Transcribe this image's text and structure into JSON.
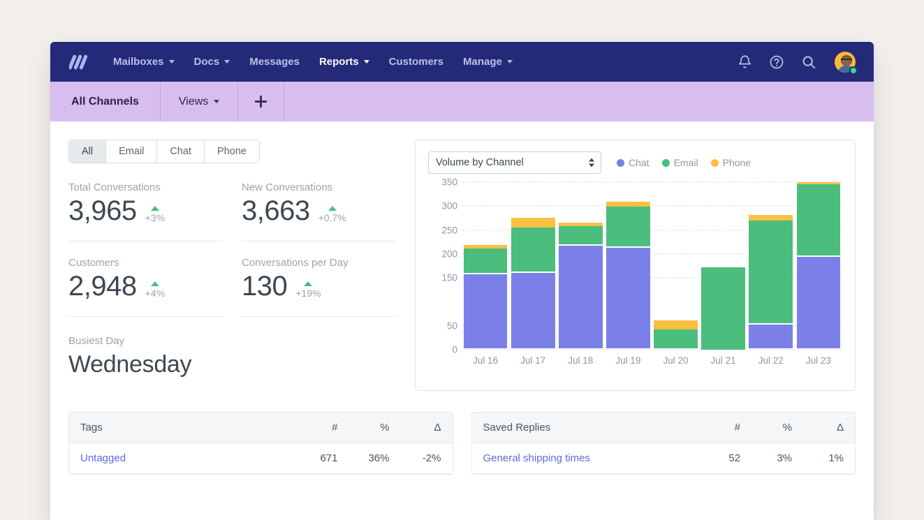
{
  "nav": {
    "logo": "helpscout-logo-icon",
    "items": [
      {
        "label": "Mailboxes",
        "caret": true,
        "active": false
      },
      {
        "label": "Docs",
        "caret": true,
        "active": false
      },
      {
        "label": "Messages",
        "caret": false,
        "active": false
      },
      {
        "label": "Reports",
        "caret": true,
        "active": true
      },
      {
        "label": "Customers",
        "caret": false,
        "active": false
      },
      {
        "label": "Manage",
        "caret": true,
        "active": false
      }
    ],
    "icons": [
      "bell-icon",
      "help-icon",
      "search-icon"
    ],
    "avatar_status": "online"
  },
  "tabbar": {
    "primary": "All Channels",
    "views": "Views",
    "add": "+"
  },
  "filters": {
    "options": [
      "All",
      "Email",
      "Chat",
      "Phone"
    ],
    "active": "All"
  },
  "stats": [
    {
      "label": "Total Conversations",
      "value": "3,965",
      "delta": "+3%",
      "trend": "up"
    },
    {
      "label": "New Conversations",
      "value": "3,663",
      "delta": "+0.7%",
      "trend": "up"
    },
    {
      "label": "Customers",
      "value": "2,948",
      "delta": "+4%",
      "trend": "up"
    },
    {
      "label": "Conversations per Day",
      "value": "130",
      "delta": "+19%",
      "trend": "up"
    }
  ],
  "busiest": {
    "label": "Busiest Day",
    "value": "Wednesday"
  },
  "chart_controls": {
    "select_value": "Volume by Channel",
    "select_options": [
      "Volume by Channel"
    ]
  },
  "colors": {
    "chat": "#7b80e8",
    "email": "#4bbd7c",
    "phone": "#fbbf42",
    "nav": "#242a78",
    "tabbar": "#d7bdf0",
    "link": "#5b6ae0",
    "positive": "#3aa76d",
    "negative": "#e8503a"
  },
  "chart_data": {
    "type": "bar",
    "stacked": true,
    "title": "Volume by Channel",
    "xlabel": "",
    "ylabel": "",
    "ylim": [
      0,
      350
    ],
    "yticks": [
      0,
      50,
      150,
      200,
      250,
      300,
      350
    ],
    "ytick_labels": [
      "0",
      "50",
      "150",
      "200",
      "250",
      "300",
      "350"
    ],
    "grid": true,
    "legend_position": "top-right",
    "categories": [
      "Jul 16",
      "Jul 17",
      "Jul 18",
      "Jul 19",
      "Jul 20",
      "Jul 21",
      "Jul 22",
      "Jul 23"
    ],
    "series": [
      {
        "name": "Chat",
        "color": "#7b80e8",
        "values": [
          155,
          157,
          214,
          210,
          0,
          0,
          50,
          193
        ]
      },
      {
        "name": "Email",
        "color": "#4bbd7c",
        "values": [
          50,
          93,
          39,
          83,
          40,
          172,
          214,
          150
        ]
      },
      {
        "name": "Phone",
        "color": "#fbbf42",
        "values": [
          8,
          20,
          6,
          10,
          18,
          0,
          12,
          5
        ]
      }
    ],
    "totals": [
      213,
      270,
      259,
      303,
      58,
      172,
      276,
      348
    ]
  },
  "tables": [
    {
      "name": "tags",
      "columns": [
        "Tags",
        "#",
        "%",
        "Δ"
      ],
      "rows": [
        {
          "label": "Untagged",
          "count": "671",
          "pct": "36%",
          "delta": "-2%",
          "delta_sign": "neg"
        }
      ]
    },
    {
      "name": "saved-replies",
      "columns": [
        "Saved Replies",
        "#",
        "%",
        "Δ"
      ],
      "rows": [
        {
          "label": "General shipping times",
          "count": "52",
          "pct": "3%",
          "delta": "1%",
          "delta_sign": "pos"
        }
      ]
    }
  ]
}
